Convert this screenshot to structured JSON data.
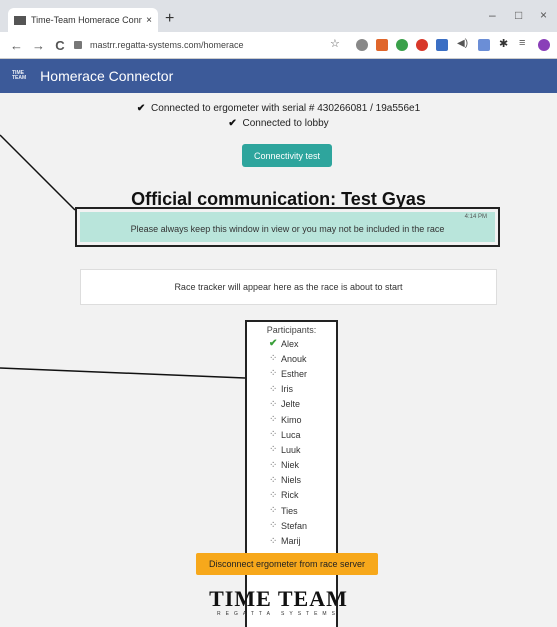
{
  "browser": {
    "tab_title": "Time-Team Homerace Conn",
    "tab_close": "×",
    "new_tab": "+",
    "minimize": "–",
    "maximize": "□",
    "close": "×",
    "back": "←",
    "forward": "→",
    "reload": "C",
    "url": "mastrr.regatta-systems.com/homerace",
    "icons": [
      "star-icon",
      "extension-icon",
      "extension-icon",
      "extension-icon",
      "extension-icon",
      "extension-icon",
      "speaker-icon",
      "extension-icon",
      "pin-icon",
      "menu-icon",
      "avatar"
    ]
  },
  "app": {
    "logo_line1": "TIME",
    "logo_line2": "TEAM",
    "title": "Homerace Connector"
  },
  "status": {
    "ergometer": "Connected to ergometer with serial # 430266081 / 19a556e1",
    "lobby": "Connected to lobby",
    "check_glyph": "✔"
  },
  "connectivity_button": "Connectivity test",
  "communication": {
    "heading": "Official communication: Test Gyas",
    "message": "Please always keep this window in view or you may not be included in the race",
    "time": "4:14 PM",
    "bg_color": "#b9e5db"
  },
  "tracker_text": "Race tracker will appear here as the race is about to start",
  "participants": {
    "title": "Participants:",
    "list": [
      {
        "name": "Alex",
        "status": "connected",
        "glyph": "✔"
      },
      {
        "name": "Anouk",
        "status": "waiting",
        "glyph": "⁘"
      },
      {
        "name": "Esther",
        "status": "waiting",
        "glyph": "⁘"
      },
      {
        "name": "Iris",
        "status": "waiting",
        "glyph": "⁘"
      },
      {
        "name": "Jelte",
        "status": "waiting",
        "glyph": "⁘"
      },
      {
        "name": "Kimo",
        "status": "waiting",
        "glyph": "⁘"
      },
      {
        "name": "Luca",
        "status": "waiting",
        "glyph": "⁘"
      },
      {
        "name": "Luuk",
        "status": "waiting",
        "glyph": "⁘"
      },
      {
        "name": "Niek",
        "status": "waiting",
        "glyph": "⁘"
      },
      {
        "name": "Niels",
        "status": "waiting",
        "glyph": "⁘"
      },
      {
        "name": "Rick",
        "status": "waiting",
        "glyph": "⁘"
      },
      {
        "name": "Ties",
        "status": "waiting",
        "glyph": "⁘"
      },
      {
        "name": "Stefan",
        "status": "waiting",
        "glyph": "⁘"
      },
      {
        "name": "Marij",
        "status": "waiting",
        "glyph": "⁘"
      }
    ]
  },
  "disconnect_button": "Disconnect ergometer from race server",
  "footer": {
    "brand": "TIME TEAM",
    "sub": "REGATTA SYSTEMS"
  },
  "colors": {
    "nav": "#3c5a99",
    "accent": "#2ea59d",
    "warning": "#f7a81b"
  }
}
